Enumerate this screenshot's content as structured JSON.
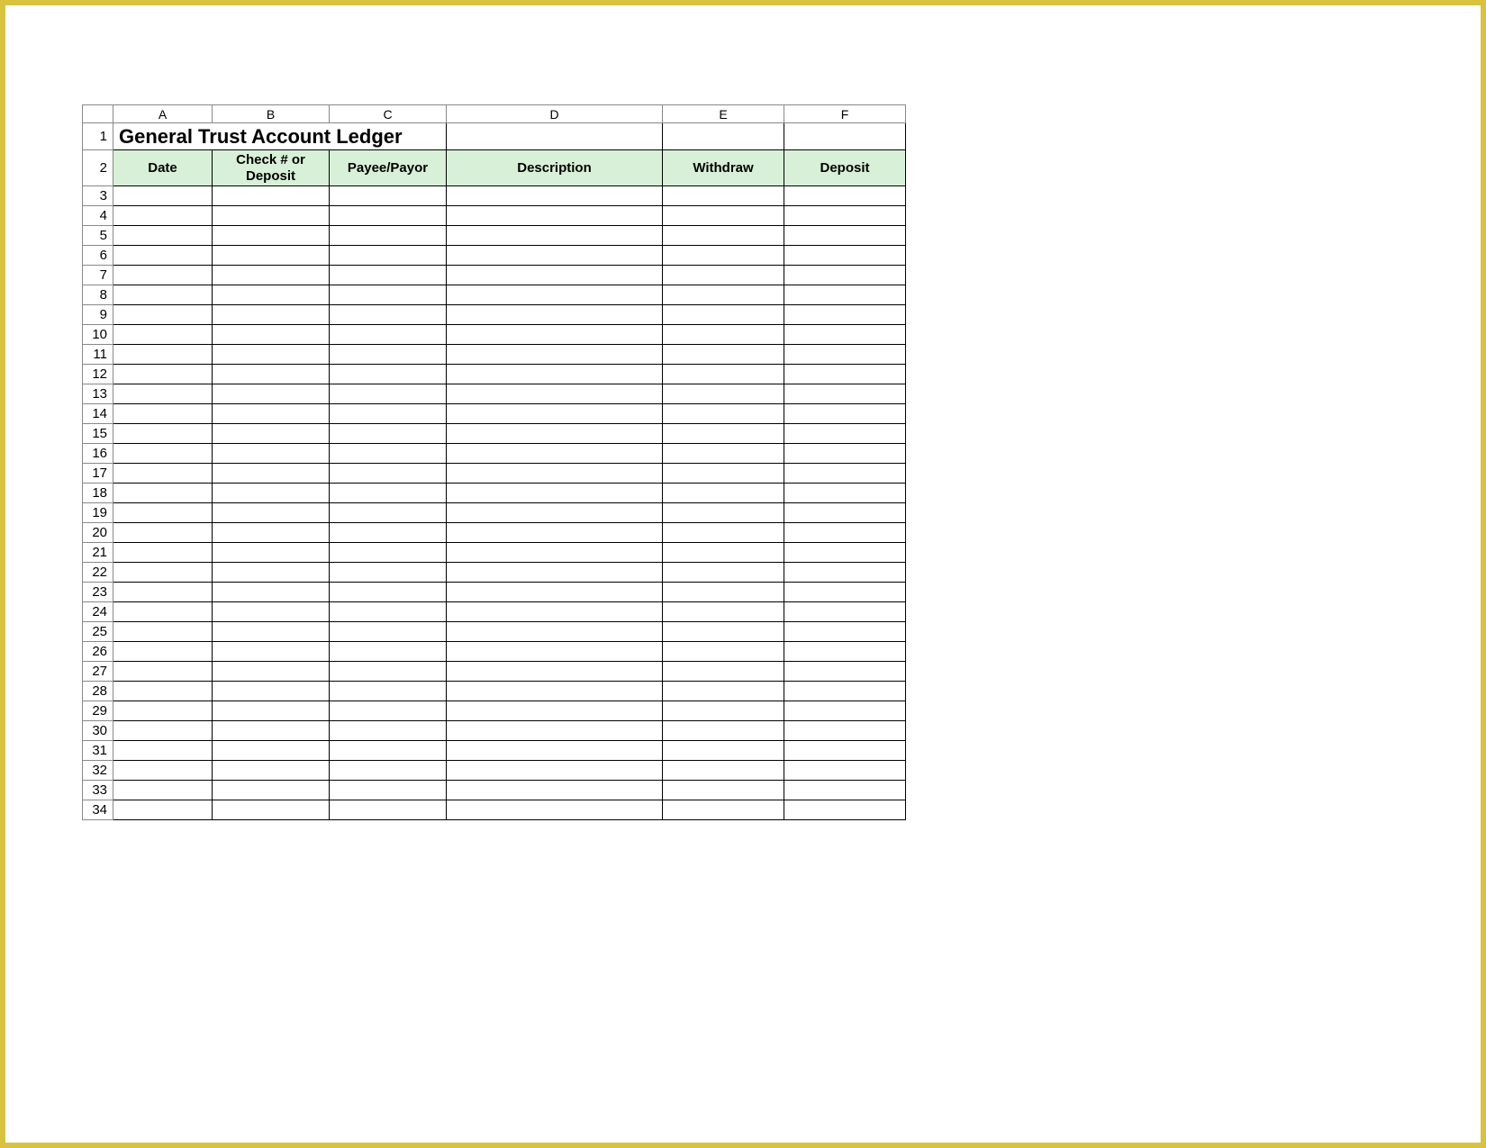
{
  "sheet": {
    "column_letters": [
      "A",
      "B",
      "C",
      "D",
      "E",
      "F"
    ],
    "title": "General Trust Account Ledger",
    "headers": {
      "A": "Date",
      "B": "Check # or Deposit",
      "C": "Payee/Payor",
      "D": "Description",
      "E": "Withdraw",
      "F": "Deposit"
    },
    "row_numbers": [
      1,
      2,
      3,
      4,
      5,
      6,
      7,
      8,
      9,
      10,
      11,
      12,
      13,
      14,
      15,
      16,
      17,
      18,
      19,
      20,
      21,
      22,
      23,
      24,
      25,
      26,
      27,
      28,
      29,
      30,
      31,
      32,
      33,
      34
    ],
    "colors": {
      "header_fill": "#d7f0d7",
      "frame_border": "#d8c23e"
    }
  }
}
